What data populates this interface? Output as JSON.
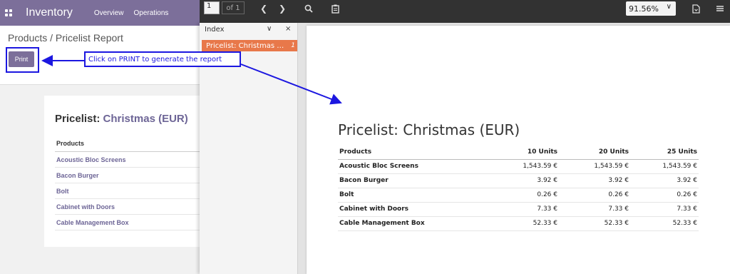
{
  "odoo": {
    "app_title": "Inventory",
    "menu": [
      "Overview",
      "Operations"
    ],
    "breadcrumb": "Products / Pricelist Report",
    "print_label": "Print",
    "report_title_prefix": "Pricelist:",
    "report_pricelist": "Christmas (EUR)",
    "table_header": "Products",
    "products": [
      "Acoustic Bloc Screens",
      "Bacon Burger",
      "Bolt",
      "Cabinet with Doors",
      "Cable Management Box"
    ]
  },
  "pdf_viewer": {
    "page_input": "1",
    "page_of": "of 1",
    "zoom": "91.56%",
    "sidebar": {
      "title": "Index",
      "item": "Pricelist: Christmas (EUR)",
      "item_page": "1"
    },
    "report": {
      "title": "Pricelist: Christmas (EUR)",
      "columns": [
        "Products",
        "10 Units",
        "20 Units",
        "25 Units"
      ],
      "rows": [
        [
          "Acoustic Bloc Screens",
          "1,543.59 €",
          "1,543.59 €",
          "1,543.59 €"
        ],
        [
          "Bacon Burger",
          "3.92 €",
          "3.92 €",
          "3.92 €"
        ],
        [
          "Bolt",
          "0.26 €",
          "0.26 €",
          "0.26 €"
        ],
        [
          "Cabinet with Doors",
          "7.33 €",
          "7.33 €",
          "7.33 €"
        ],
        [
          "Cable Management Box",
          "52.33 €",
          "52.33 €",
          "52.33 €"
        ]
      ]
    }
  },
  "annotation": {
    "text": "Click on PRINT to generate the report",
    "color": "#1c17e0"
  },
  "colors": {
    "odoo_primary": "#7c6f9a",
    "sidebar_active": "#e8784a",
    "toolbar": "#323232"
  }
}
